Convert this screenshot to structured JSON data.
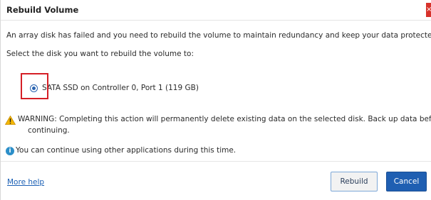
{
  "dialog": {
    "title": "Rebuild Volume",
    "close_glyph": "×",
    "message": "An array disk has failed and you need to rebuild the volume to maintain redundancy and keep your data protected",
    "select_prompt": "Select the disk you want to rebuild the volume to:",
    "disk_option": {
      "label": "SATA SSD on Controller 0, Port 1 (119 GB)",
      "selected": true
    },
    "warning_line1": "WARNING: Completing this action will permanently delete existing data on the selected disk. Back up data befo",
    "warning_line2": "continuing.",
    "info_text": "You can continue using other applications during this time.",
    "info_glyph": "i",
    "more_help": "More help",
    "rebuild_label": "Rebuild",
    "cancel_label": "Cancel"
  },
  "colors": {
    "accent": "#1f5fb2",
    "highlight": "#d51f26",
    "warning": "#f5b700",
    "info": "#2c8fc9"
  }
}
